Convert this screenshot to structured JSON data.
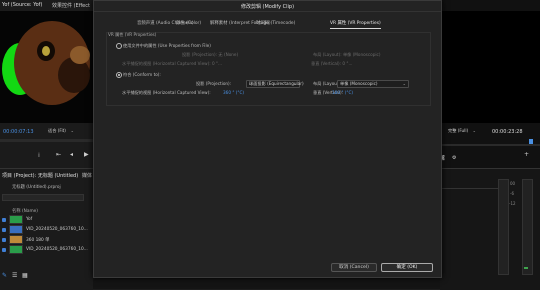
{
  "source_panel": {
    "tab_source": "Yof (Source: Yof)",
    "tab_effects": "效果控件 (Effect",
    "timecode": "00:00:07:13",
    "fit_label": "适合 (Fit)",
    "transport_icons": [
      "mark-in-icon",
      "step-back-icon",
      "play-icon"
    ]
  },
  "program_panel": {
    "quality_label": "完整 (Full)",
    "timecode": "00:00:23:28"
  },
  "project_panel": {
    "tab_project": "项目 (Project): 无标题 (Untitled)",
    "tab_media": "媒体",
    "project_file": "无标题 (Untitled).prproj",
    "name_header": "名称 (Name)",
    "items": [
      {
        "name": "Yof",
        "color": "#2a9d4a",
        "checked": true
      },
      {
        "name": "VID_20240520_063760_10...",
        "color": "#3a6fbf",
        "checked": true
      },
      {
        "name": "360 180 单",
        "color": "#bf8a3a",
        "checked": true
      },
      {
        "name": "VID_20240520_063760_10...",
        "color": "#2a9d4a",
        "checked": true
      }
    ]
  },
  "dialog": {
    "title": "修改剪辑 (Modify Clip)",
    "tabs": [
      {
        "label": "音频声道 (Audio Channels)",
        "active": false
      },
      {
        "label": "颜色 (Color)",
        "active": false
      },
      {
        "label": "解释素材 (Interpret Footage)",
        "active": false
      },
      {
        "label": "时间码 (Timecode)",
        "active": false
      },
      {
        "label": "VR 属性 (VR Properties)",
        "active": true
      }
    ],
    "group_title": "VR 属性 (VR Properties)",
    "option_file": {
      "label": "使用文件中的属性 (Use Properties from File)",
      "projection_label": "投影 (Projection): 无 (None)",
      "layout_label": "布局 (Layout): 单像 (Monoscopic)",
      "h_view_label": "水平捕捉的视图 (Horizontal Captured View): 0 °...",
      "v_label": "垂直 (Vertical): 0 °..."
    },
    "option_conform": {
      "label": "符合 (Conform to):",
      "projection_label": "投影 (Projection):",
      "projection_value": "球面投影 (Equirectangular)",
      "layout_label": "布局 (Layout):",
      "layout_value": "单像 (Monoscopic)",
      "h_view_label": "水平捕捉的视图 (Horizontal Captured View):",
      "h_view_value": "360 ° (°C)",
      "v_label": "垂直 (Vertical):",
      "v_value": "180 ° (°C)"
    },
    "cancel_label": "取消 (Cancel)",
    "ok_label": "确定 (OK)"
  },
  "timeline": {
    "ruler_labels": [
      "00",
      "-6",
      "-12"
    ],
    "colors": {
      "accent": "#4a90e2",
      "meter": "#3fa34d"
    }
  }
}
